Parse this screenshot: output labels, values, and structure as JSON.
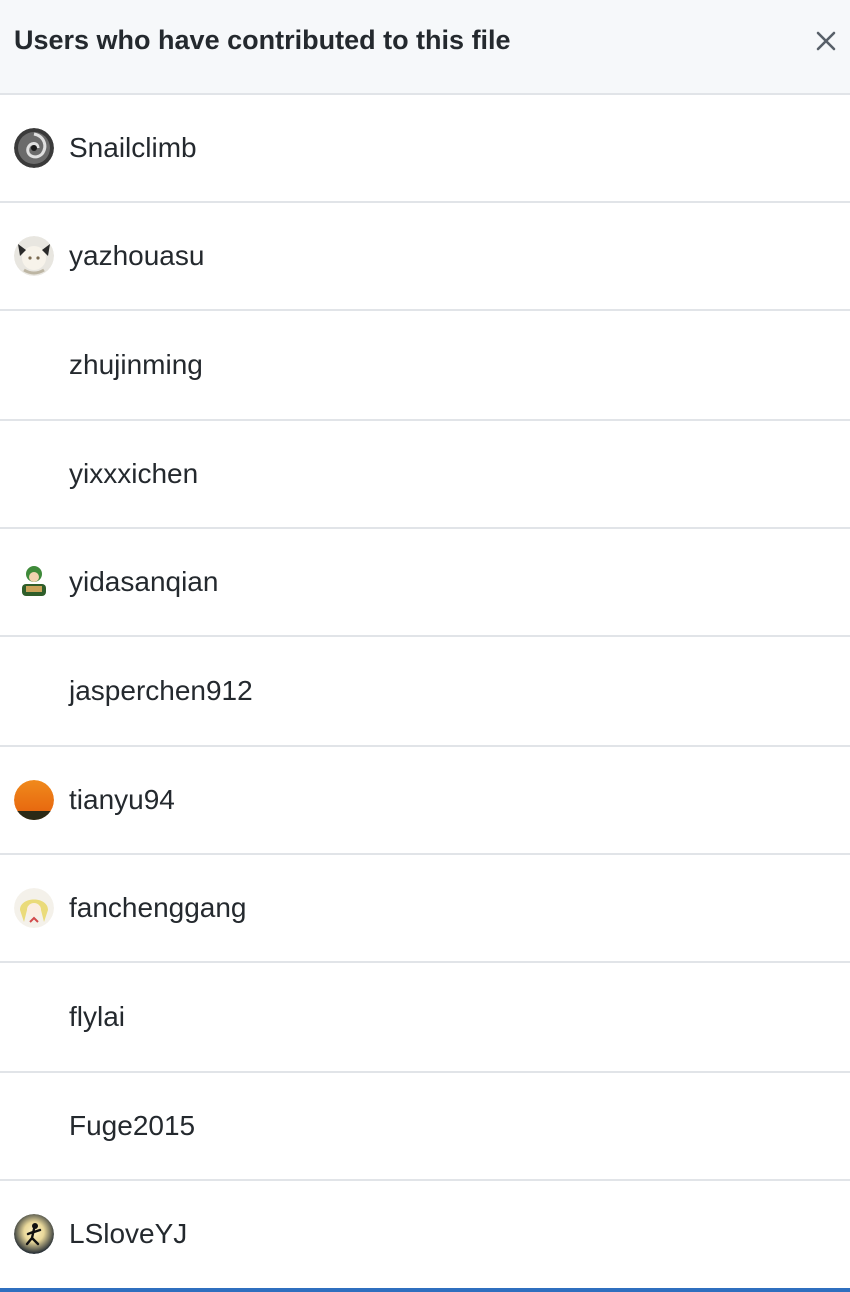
{
  "dialog": {
    "title": "Users who have contributed to this file",
    "close_icon": "close-icon"
  },
  "contributors": [
    {
      "name": "Snailclimb",
      "avatar": "avatar-swirl"
    },
    {
      "name": "yazhouasu",
      "avatar": "avatar-anime-face"
    },
    {
      "name": "zhujinming",
      "avatar": "none"
    },
    {
      "name": "yixxxichen",
      "avatar": "none"
    },
    {
      "name": "yidasanqian",
      "avatar": "avatar-green-character"
    },
    {
      "name": "jasperchen912",
      "avatar": "none"
    },
    {
      "name": "tianyu94",
      "avatar": "avatar-sunset"
    },
    {
      "name": "fanchenggang",
      "avatar": "avatar-blonde-anime"
    },
    {
      "name": "flylai",
      "avatar": "none"
    },
    {
      "name": "Fuge2015",
      "avatar": "none"
    },
    {
      "name": "LSloveYJ",
      "avatar": "avatar-silhouette"
    }
  ],
  "colors": {
    "header_bg": "#f6f8fa",
    "divider": "#e1e4e8",
    "text": "#24292e",
    "accent_bar": "#2f6fbf"
  }
}
